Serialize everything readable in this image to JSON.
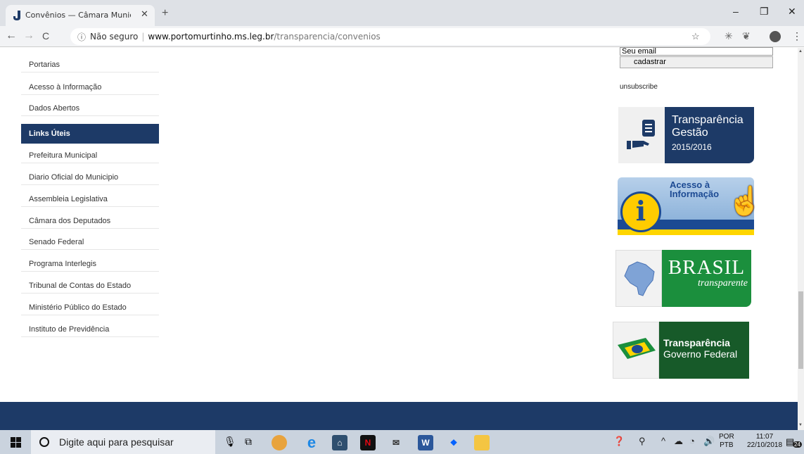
{
  "browser": {
    "tab_title": "Convênios — Câmara Municipal",
    "tab_close": "✕",
    "new_tab": "+",
    "window_minimize": "–",
    "window_restore": "❐",
    "window_close": "✕",
    "back": "←",
    "forward": "→",
    "reload": "C",
    "security_text": "Não seguro",
    "url_separator": "|",
    "url_host": "www.portomurtinho.ms.leg.br",
    "url_path": "/transparencia/convenios",
    "bookmark_star": "☆",
    "menu": "⋮"
  },
  "sidebar": {
    "top_items": [
      {
        "label": "Portarias"
      },
      {
        "label": "Acesso à Informação"
      },
      {
        "label": "Dados Abertos"
      }
    ],
    "links_header": "Links Úteis",
    "links": [
      {
        "label": "Prefeitura Municipal"
      },
      {
        "label": "Diario Oficial do Municipio"
      },
      {
        "label": "Assembleia Legislativa"
      },
      {
        "label": "Câmara dos Deputados"
      },
      {
        "label": "Senado Federal"
      },
      {
        "label": "Programa Interlegis"
      },
      {
        "label": "Tribunal de Contas do Estado"
      },
      {
        "label": "Ministério Público do Estado"
      },
      {
        "label": "Instituto de Previdência"
      }
    ]
  },
  "newsletter": {
    "email_placeholder": "Seu email",
    "subscribe_label": "cadastrar",
    "unsubscribe_label": "unsubscribe"
  },
  "banners": {
    "gestao": {
      "line1": "Transparência",
      "line2": "Gestão",
      "line3": "2015/2016"
    },
    "acesso": {
      "line1": "Acesso à",
      "line2": "Informação",
      "symbol": "i"
    },
    "brasil": {
      "line1": "BRASIL",
      "line2": "transparente"
    },
    "federal": {
      "line1": "Transparência",
      "line2": "Governo Federal"
    }
  },
  "taskbar": {
    "search_placeholder": "Digite aqui para pesquisar",
    "language_line1": "POR",
    "language_line2": "PTB",
    "time": "11:07",
    "date": "22/10/2018",
    "notification_count": "24"
  },
  "colors": {
    "navy": "#1d3a67",
    "green": "#1b8f3d",
    "dark_green": "#175a29",
    "yellow": "#ffcc00"
  }
}
